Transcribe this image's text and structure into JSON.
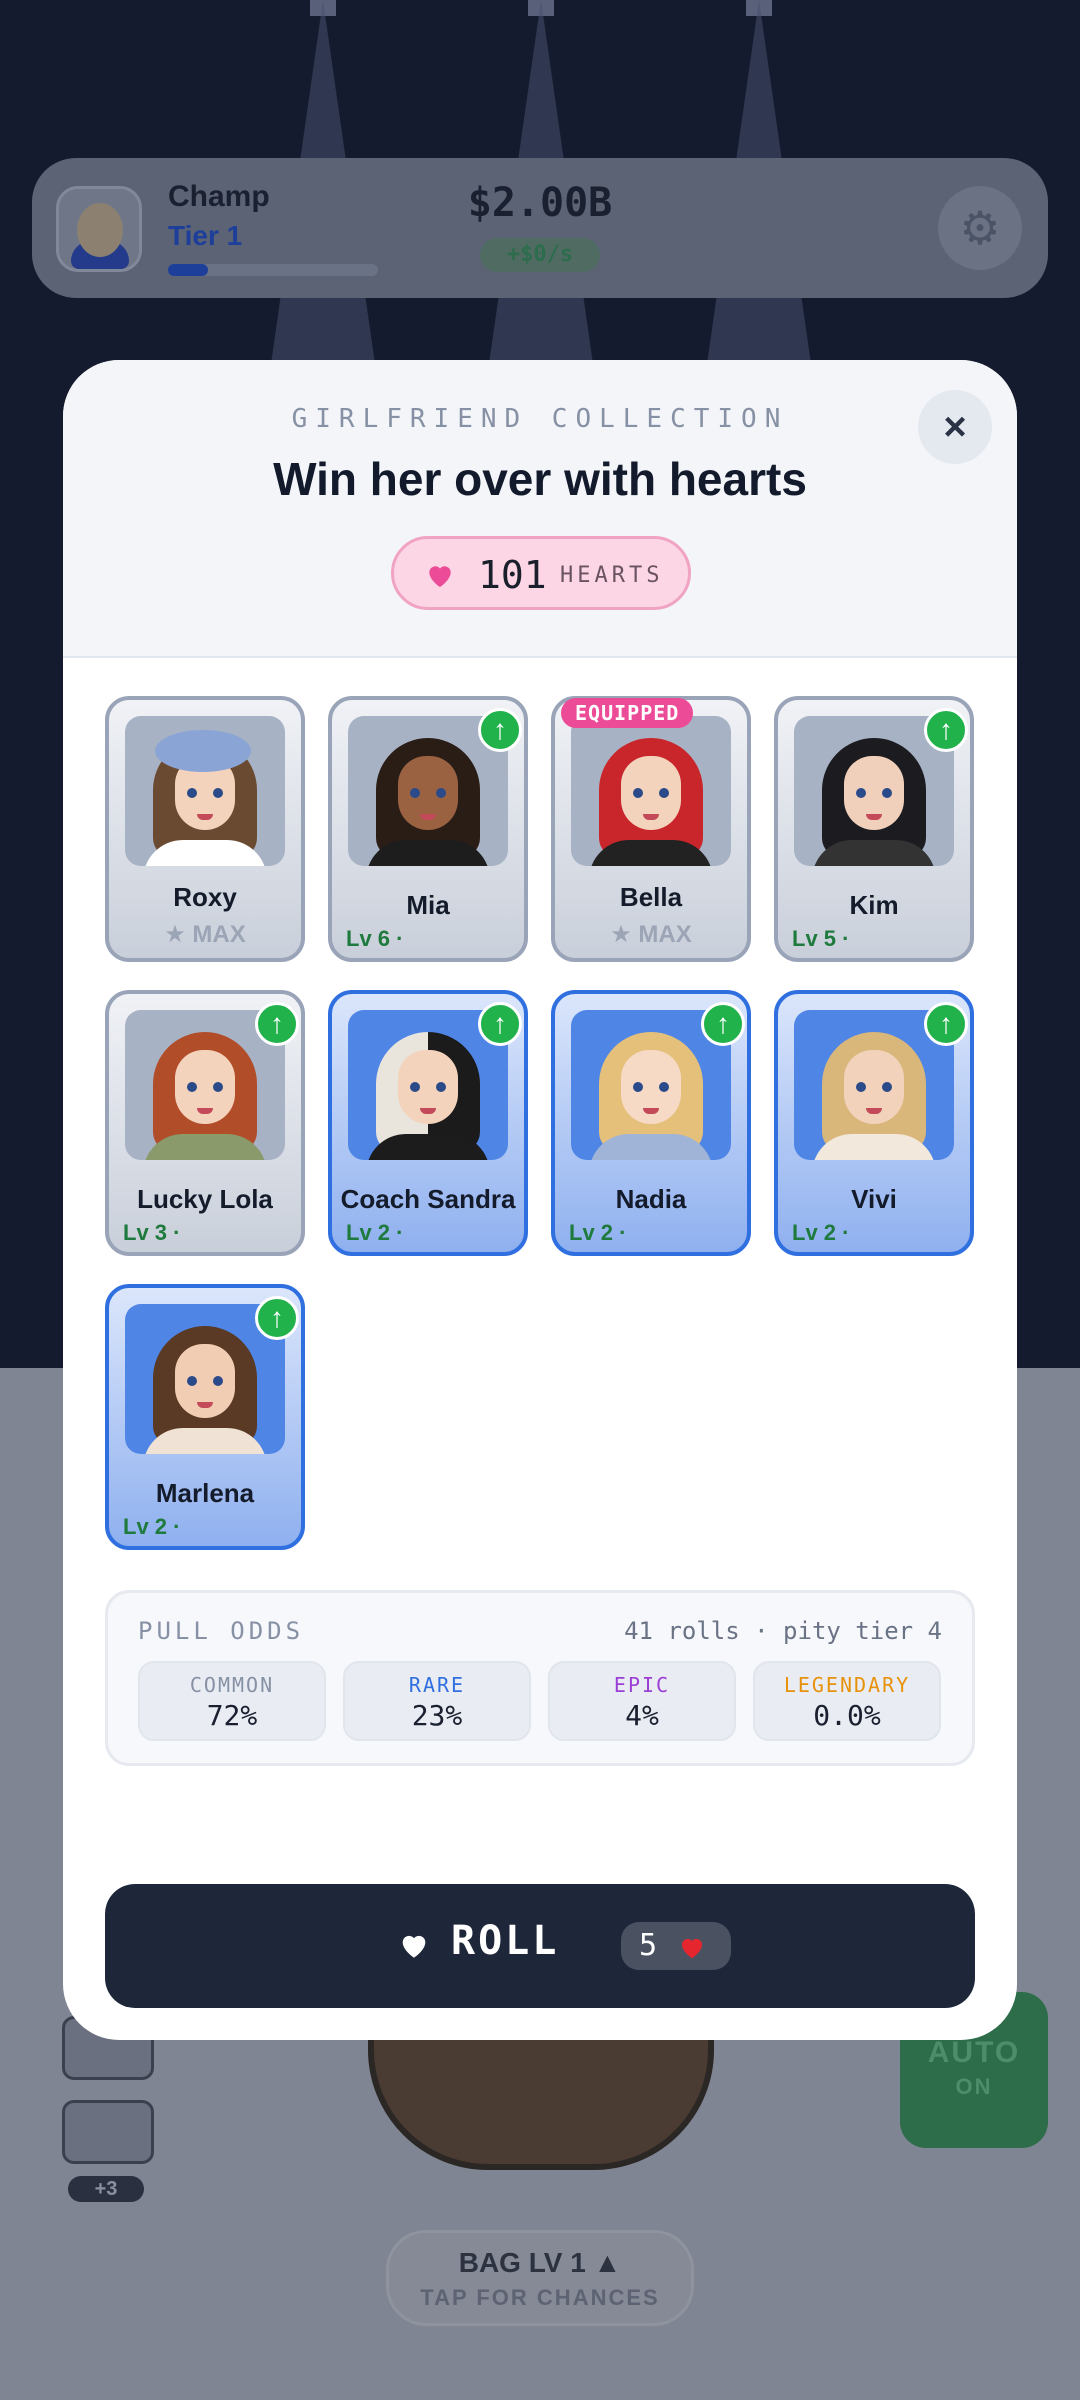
{
  "hud": {
    "player_name": "Champ",
    "tier": "Tier 1",
    "tier_progress": 0.19,
    "money": "$2.00B",
    "rate": "+$0/s"
  },
  "background": {
    "bag_title": "BAG LV 1 ▲",
    "bag_subtitle": "TAP FOR CHANCES",
    "auto_label": "AUTO",
    "auto_state": "ON",
    "extra_count": "+3"
  },
  "modal": {
    "kicker": "GIRLFRIEND COLLECTION",
    "title": "Win her over with hearts",
    "close_icon": "×",
    "hearts_count": "101",
    "hearts_label": "HEARTS",
    "equipped_label": "EQUIPPED",
    "upgrade_icon": "↑",
    "max_label": "★ MAX"
  },
  "girlfriends": [
    {
      "name": "Roxy",
      "level": "",
      "max": true,
      "rarity": "common",
      "upgradable": false,
      "equipped": false
    },
    {
      "name": "Mia",
      "level": "Lv 6 ·",
      "max": false,
      "rarity": "common",
      "upgradable": true,
      "equipped": false
    },
    {
      "name": "Bella",
      "level": "",
      "max": true,
      "rarity": "common",
      "upgradable": false,
      "equipped": true
    },
    {
      "name": "Kim",
      "level": "Lv 5 ·",
      "max": false,
      "rarity": "common",
      "upgradable": true,
      "equipped": false
    },
    {
      "name": "Lucky Lola",
      "level": "Lv 3 ·",
      "max": false,
      "rarity": "common",
      "upgradable": true,
      "equipped": false
    },
    {
      "name": "Coach Sandra",
      "level": "Lv 2 ·",
      "max": false,
      "rarity": "rare",
      "upgradable": true,
      "equipped": false
    },
    {
      "name": "Nadia",
      "level": "Lv 2 ·",
      "max": false,
      "rarity": "rare",
      "upgradable": true,
      "equipped": false
    },
    {
      "name": "Vivi",
      "level": "Lv 2 ·",
      "max": false,
      "rarity": "rare",
      "upgradable": true,
      "equipped": false
    },
    {
      "name": "Marlena",
      "level": "Lv 2 ·",
      "max": false,
      "rarity": "rare",
      "upgradable": true,
      "equipped": false
    }
  ],
  "odds": {
    "title": "PULL ODDS",
    "meta": "41 rolls · pity tier 4",
    "tiers": [
      {
        "name": "COMMON",
        "value": "72%",
        "color": "#8791a5"
      },
      {
        "name": "RARE",
        "value": "23%",
        "color": "#2f6fe0"
      },
      {
        "name": "EPIC",
        "value": "4%",
        "color": "#9b3fd6"
      },
      {
        "name": "LEGENDARY",
        "value": "0.0%",
        "color": "#e8920c"
      }
    ]
  },
  "roll": {
    "label": "ROLL",
    "cost": "5"
  },
  "colors": {
    "accent_blue": "#2f6fe0",
    "upgrade_green": "#22b24c",
    "equipped_pink": "#ec4b97",
    "heart_pink": "#ec4b97",
    "heart_red": "#e5262e",
    "roll_button": "#1e273a"
  },
  "icons": {
    "close": "close-icon",
    "heart": "heart-icon",
    "upgrade": "arrow-up-icon",
    "settings": "gear-icon"
  }
}
